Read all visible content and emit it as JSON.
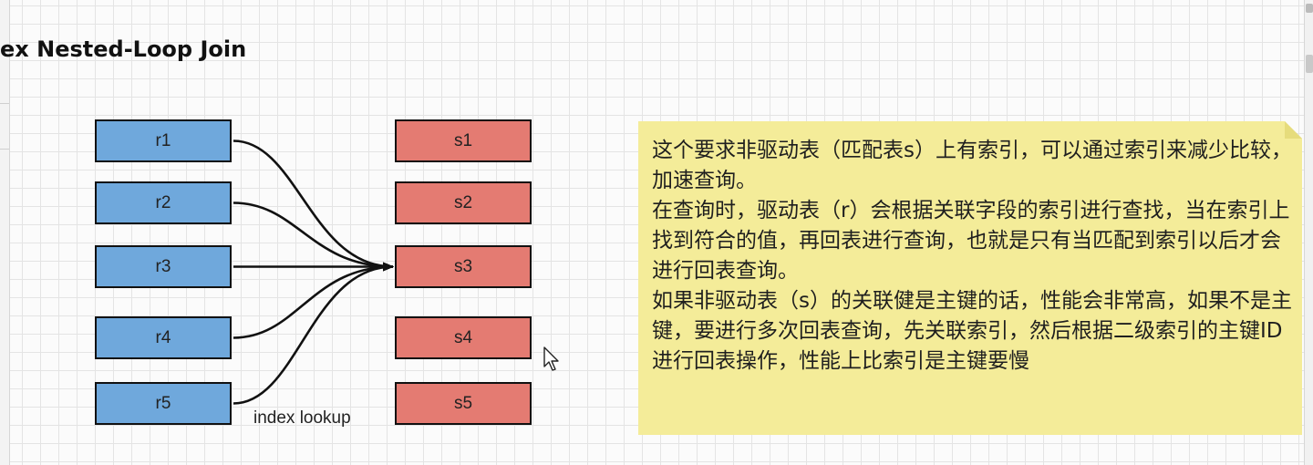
{
  "title": "ex Nested-Loop Join",
  "driving_table": [
    {
      "id": "r1",
      "label": "r1"
    },
    {
      "id": "r2",
      "label": "r2"
    },
    {
      "id": "r3",
      "label": "r3"
    },
    {
      "id": "r4",
      "label": "r4"
    },
    {
      "id": "r5",
      "label": "r5"
    }
  ],
  "matched_table": [
    {
      "id": "s1",
      "label": "s1"
    },
    {
      "id": "s2",
      "label": "s2"
    },
    {
      "id": "s3",
      "label": "s3"
    },
    {
      "id": "s4",
      "label": "s4"
    },
    {
      "id": "s5",
      "label": "s5"
    }
  ],
  "edges": [
    {
      "from": "r1",
      "to": "s3"
    },
    {
      "from": "r2",
      "to": "s3"
    },
    {
      "from": "r3",
      "to": "s3"
    },
    {
      "from": "r4",
      "to": "s3"
    },
    {
      "from": "r5",
      "to": "s3"
    }
  ],
  "edge_label": "index lookup",
  "note": {
    "text": "这个要求非驱动表（匹配表s）上有索引，可以通过索引来减少比较，加速查询。\n在查询时，驱动表（r）会根据关联字段的索引进行查找，当在索引上找到符合的值，再回表进行查询，也就是只有当匹配到索引以后才会进行回表查询。\n如果非驱动表（s）的关联健是主键的话，性能会非常高，如果不是主键，要进行多次回表查询，先关联索引，然后根据二级索引的主键ID进行回表操作，性能上比索引是主键要慢"
  },
  "colors": {
    "r_fill": "#6fa8dc",
    "s_fill": "#e47b72",
    "note_fill": "#f4ec99",
    "stroke": "#111111"
  }
}
